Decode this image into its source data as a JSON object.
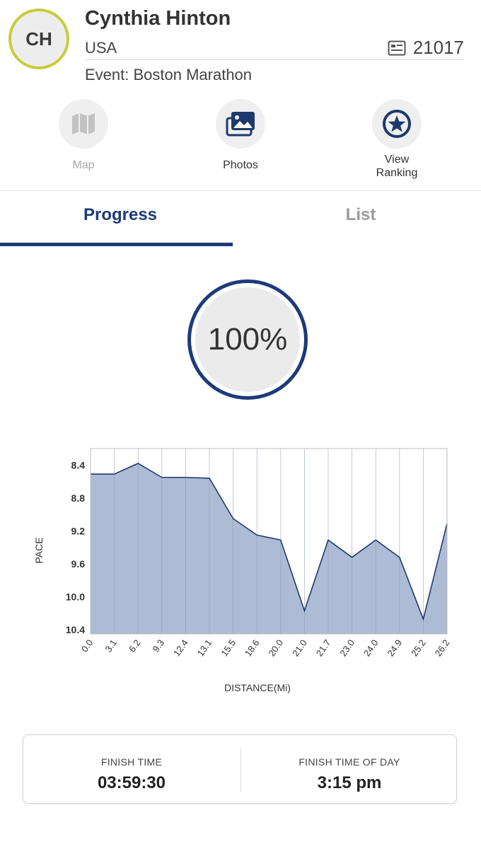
{
  "athlete": {
    "initials": "CH",
    "name": "Cynthia Hinton",
    "country": "USA",
    "bib_number": "21017",
    "event": "Event: Boston Marathon"
  },
  "actions": [
    {
      "label": "Map",
      "icon": "map-icon",
      "enabled": false
    },
    {
      "label": "Photos",
      "icon": "photos-icon",
      "enabled": true
    },
    {
      "label": "View\nRanking",
      "icon": "star-ranking-icon",
      "enabled": true
    }
  ],
  "tabs": [
    {
      "label": "Progress",
      "active": true
    },
    {
      "label": "List",
      "active": false
    }
  ],
  "progress": {
    "percent_label": "100%",
    "value": 1.0
  },
  "colors": {
    "accent": "#1d3a7a",
    "avatar_ring": "#c8cc3a",
    "chart_fill": "#aebbd4",
    "chart_line": "#1d3a6e"
  },
  "chart_data": {
    "type": "area",
    "xlabel": "DISTANCE(Mi)",
    "ylabel": "PACE",
    "x": [
      "0.0",
      "3.1",
      "6.2",
      "9.3",
      "12.4",
      "13.1",
      "15.5",
      "18.6",
      "20.0",
      "21.0",
      "21.7",
      "23.0",
      "24.0",
      "24.9",
      "25.2",
      "26.2"
    ],
    "values": [
      8.51,
      8.51,
      8.38,
      8.55,
      8.55,
      8.56,
      9.05,
      9.25,
      9.31,
      10.17,
      9.31,
      9.52,
      9.31,
      9.52,
      10.27,
      9.11
    ],
    "y_ticks": [
      "8.4",
      "8.8",
      "9.2",
      "9.6",
      "10.0",
      "10.4"
    ],
    "ylim": [
      8.2,
      10.45
    ],
    "y_inverted": true,
    "grid": "vertical"
  },
  "finish": {
    "time_label": "FINISH TIME",
    "time_value": "03:59:30",
    "time_of_day_label": "FINISH TIME OF DAY",
    "time_of_day_value": "3:15 pm"
  }
}
